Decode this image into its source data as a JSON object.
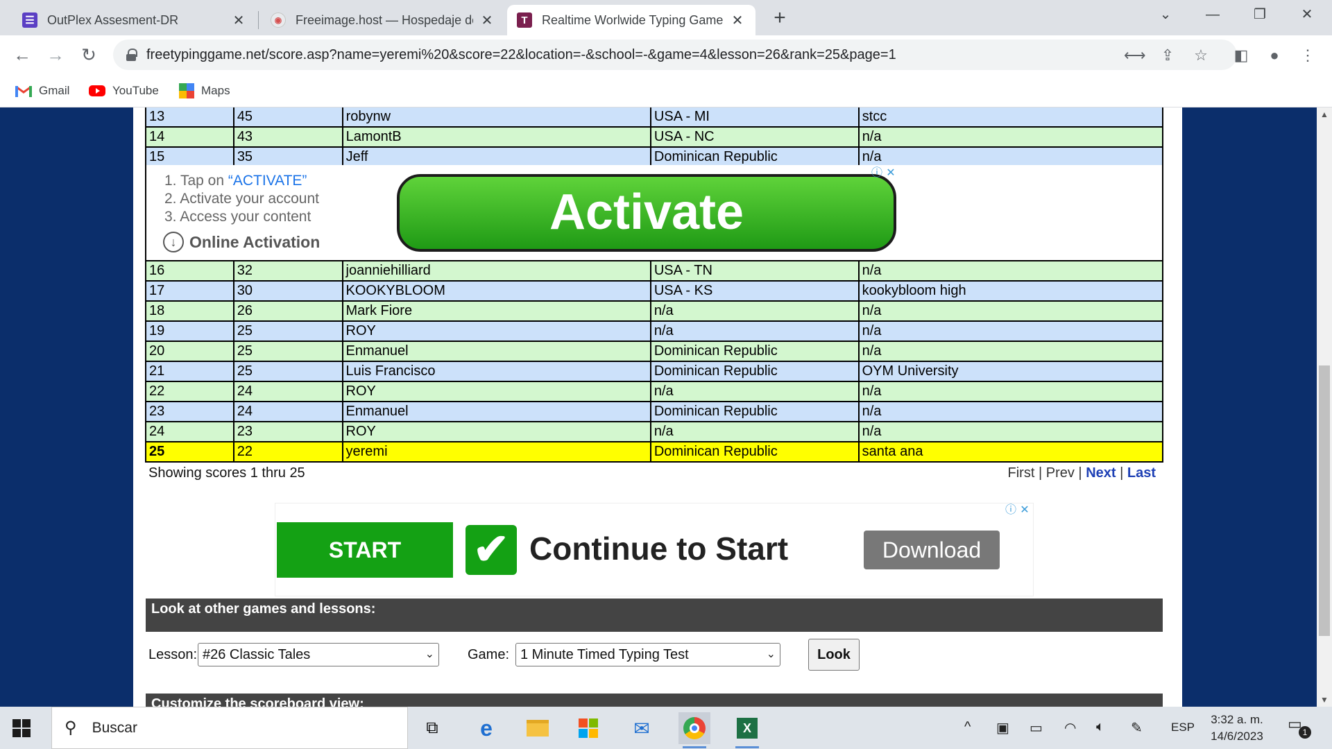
{
  "browser": {
    "tabs": [
      {
        "title": "OutPlex Assesment-DR",
        "icon": "forms-icon",
        "color": "#5b3fc4",
        "active": false
      },
      {
        "title": "Freeimage.host — Hospedaje de",
        "icon": "freeimage-icon",
        "color": "#e8eaed",
        "active": false
      },
      {
        "title": "Realtime Worlwide Typing Game",
        "icon": "typing-t-icon",
        "color": "#7a1f4e",
        "active": true
      }
    ],
    "url": "freetypinggame.net/score.asp?name=yeremi%20&score=22&location=-&school=-&game=4&lesson=26&rank=25&page=1",
    "bookmarks": [
      {
        "label": "Gmail",
        "icon": "gmail-icon"
      },
      {
        "label": "YouTube",
        "icon": "youtube-icon"
      },
      {
        "label": "Maps",
        "icon": "maps-icon"
      }
    ]
  },
  "scores_top": [
    {
      "rank": "13",
      "score": "45",
      "name": "robynw",
      "location": "USA - MI",
      "school": "stcc",
      "style": "blue"
    },
    {
      "rank": "14",
      "score": "43",
      "name": "LamontB",
      "location": "USA - NC",
      "school": "n/a",
      "style": "green"
    },
    {
      "rank": "15",
      "score": "35",
      "name": "Jeff",
      "location": "Dominican Republic",
      "school": "n/a",
      "style": "blue"
    }
  ],
  "ad1": {
    "step1_prefix": "1. Tap on ",
    "step1_highlight": "“ACTIVATE”",
    "step2": "2. Activate your account",
    "step3": "3. Access your content",
    "online": "Online Activation",
    "button": "Activate"
  },
  "scores_bottom": [
    {
      "rank": "16",
      "score": "32",
      "name": "joanniehilliard",
      "location": "USA - TN",
      "school": "n/a",
      "style": "green"
    },
    {
      "rank": "17",
      "score": "30",
      "name": "KOOKYBLOOM",
      "location": "USA - KS",
      "school": "kookybloom high",
      "style": "blue"
    },
    {
      "rank": "18",
      "score": "26",
      "name": "Mark Fiore",
      "location": "n/a",
      "school": "n/a",
      "style": "green"
    },
    {
      "rank": "19",
      "score": "25",
      "name": "ROY",
      "location": "n/a",
      "school": "n/a",
      "style": "blue"
    },
    {
      "rank": "20",
      "score": "25",
      "name": "Enmanuel",
      "location": "Dominican Republic",
      "school": "n/a",
      "style": "green"
    },
    {
      "rank": "21",
      "score": "25",
      "name": "Luis Francisco",
      "location": "Dominican Republic",
      "school": "OYM University",
      "style": "blue"
    },
    {
      "rank": "22",
      "score": "24",
      "name": "ROY",
      "location": "n/a",
      "school": "n/a",
      "style": "green"
    },
    {
      "rank": "23",
      "score": "24",
      "name": "Enmanuel",
      "location": "Dominican Republic",
      "school": "n/a",
      "style": "blue"
    },
    {
      "rank": "24",
      "score": "23",
      "name": "ROY",
      "location": "n/a",
      "school": "n/a",
      "style": "green"
    },
    {
      "rank": "25",
      "score": "22",
      "name": "yeremi",
      "location": "Dominican Republic",
      "school": "santa ana",
      "style": "me"
    }
  ],
  "pagination": {
    "showing": "Showing scores 1 thru 25",
    "first": "First",
    "prev": "Prev",
    "next": "Next",
    "last": "Last",
    "sep": "|"
  },
  "ad2": {
    "start": "START",
    "continue": "Continue to Start",
    "download": "Download"
  },
  "lookup": {
    "heading": "Look at other games and lessons:",
    "lesson_label": "Lesson:",
    "lesson_value": "#26 Classic Tales",
    "game_label": "Game:",
    "game_value": "1 Minute Timed Typing Test",
    "look_button": "Look"
  },
  "customize": {
    "heading": "Customize the scoreboard view:"
  },
  "taskbar": {
    "search_placeholder": "Buscar",
    "language": "ESP",
    "time": "3:32 a. m.",
    "date": "14/6/2023",
    "notifications": "1"
  },
  "colors": {
    "row_blue": "#cce1fa",
    "row_green": "#d3f7cf",
    "row_highlight": "#ffff00",
    "page_background": "#0b2e6b",
    "link": "#1e40b5"
  }
}
